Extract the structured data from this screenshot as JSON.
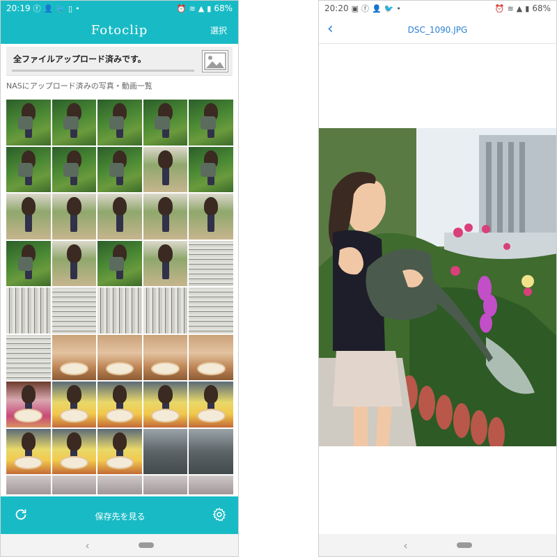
{
  "left": {
    "status": {
      "time": "20:19",
      "battery": "68%"
    },
    "app_title": "Fotoclip",
    "select_label": "選択",
    "banner_text": "全ファイルアップロード済みです。",
    "section_label": "NASにアップロード済みの写真・動画一覧",
    "bottom_label": "保存先を見る",
    "icons": {
      "refresh": "refresh-icon",
      "settings": "gear-icon",
      "image": "image-icon"
    },
    "thumbs": [
      "garden",
      "garden",
      "garden",
      "garden",
      "garden",
      "garden",
      "garden",
      "garden",
      "path",
      "garden",
      "path",
      "path",
      "path",
      "path",
      "path",
      "garden",
      "path",
      "garden",
      "path",
      "paper",
      "paper2",
      "paper",
      "paper2",
      "paper2",
      "paper",
      "paper",
      "eat",
      "eat",
      "eat",
      "eat",
      "pink",
      "yellow",
      "yellow",
      "yellow",
      "yellow",
      "yellow",
      "yellow",
      "yellow",
      "street",
      "street",
      "tree",
      "tree",
      "tree",
      "tree",
      "tree"
    ]
  },
  "right": {
    "status": {
      "time": "20:20",
      "battery": "68%"
    },
    "filename": "DSC_1090.JPG"
  },
  "colors": {
    "accent": "#18bbc5",
    "link": "#2a7fd4"
  }
}
